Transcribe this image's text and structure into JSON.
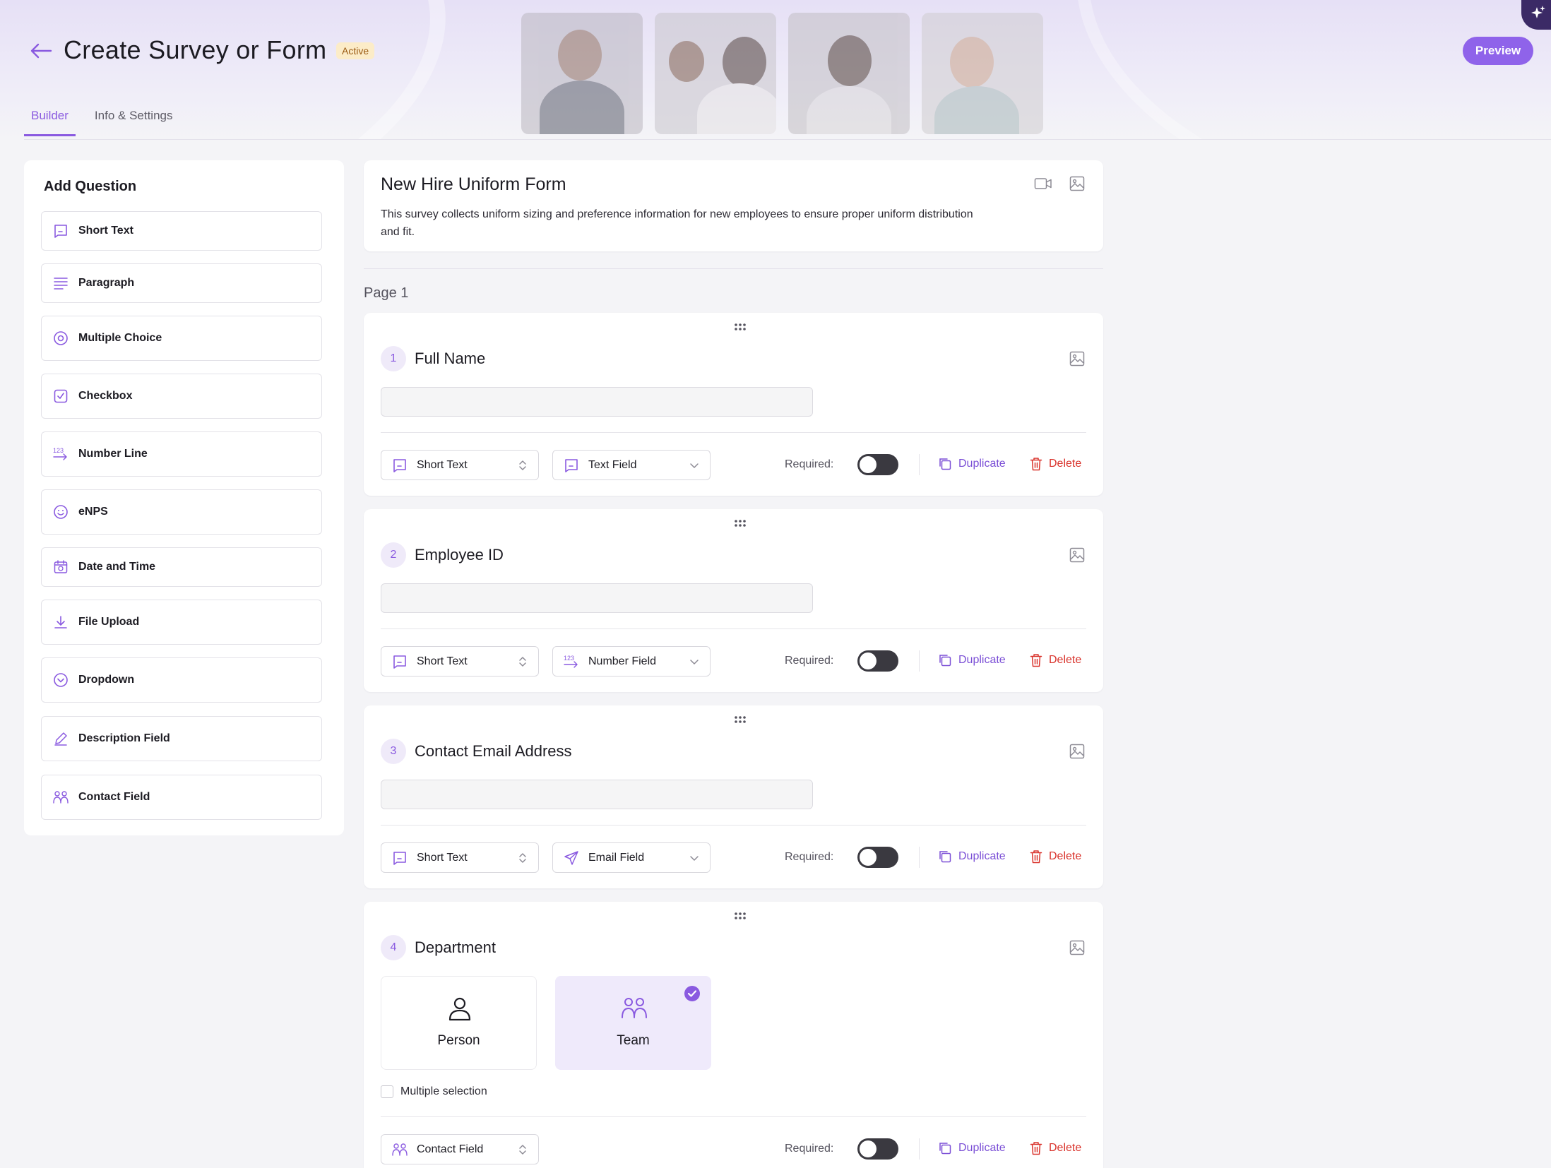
{
  "header": {
    "title": "Create Survey or Form",
    "status": "Active",
    "preview_label": "Preview",
    "tabs": [
      {
        "label": "Builder",
        "active": true
      },
      {
        "label": "Info & Settings",
        "active": false
      }
    ]
  },
  "sidebar": {
    "title": "Add Question",
    "items": [
      {
        "label": "Short Text",
        "icon": "chat-box-icon"
      },
      {
        "label": "Paragraph",
        "icon": "paragraph-lines-icon"
      },
      {
        "label": "Multiple Choice",
        "icon": "radio-circle-icon"
      },
      {
        "label": "Checkbox",
        "icon": "checkbox-icon"
      },
      {
        "label": "Number Line",
        "icon": "number-arrow-icon"
      },
      {
        "label": "eNPS",
        "icon": "smiley-icon"
      },
      {
        "label": "Date and Time",
        "icon": "calendar-icon"
      },
      {
        "label": "File Upload",
        "icon": "download-icon"
      },
      {
        "label": "Dropdown",
        "icon": "chevron-circle-icon"
      },
      {
        "label": "Description Field",
        "icon": "pencil-icon"
      },
      {
        "label": "Contact Field",
        "icon": "people-icon"
      }
    ]
  },
  "form": {
    "title": "New Hire Uniform Form",
    "description": "This survey collects uniform sizing and preference information for new employees to ensure proper uniform distribution and fit.",
    "page_label": "Page 1"
  },
  "questions": [
    {
      "number": "1",
      "title": "Full Name",
      "type_label": "Short Text",
      "subtype_label": "Text Field",
      "subtype_icon": "chat-box-icon",
      "required_label": "Required:",
      "required": false,
      "duplicate_label": "Duplicate",
      "delete_label": "Delete"
    },
    {
      "number": "2",
      "title": "Employee ID",
      "type_label": "Short Text",
      "subtype_label": "Number Field",
      "subtype_icon": "number-arrow-icon",
      "required_label": "Required:",
      "required": false,
      "duplicate_label": "Duplicate",
      "delete_label": "Delete"
    },
    {
      "number": "3",
      "title": "Contact Email Address",
      "type_label": "Short Text",
      "subtype_label": "Email Field",
      "subtype_icon": "paper-plane-icon",
      "required_label": "Required:",
      "required": false,
      "duplicate_label": "Duplicate",
      "delete_label": "Delete"
    },
    {
      "number": "4",
      "title": "Department",
      "type_label": "Contact Field",
      "required_label": "Required:",
      "required": false,
      "duplicate_label": "Duplicate",
      "delete_label": "Delete",
      "options": [
        {
          "label": "Person",
          "icon": "person-icon",
          "selected": false
        },
        {
          "label": "Team",
          "icon": "team-icon",
          "selected": true
        }
      ],
      "multiple_selection_label": "Multiple selection",
      "multiple_selection": false
    }
  ],
  "colors": {
    "accent": "#8a5ae0",
    "delete": "#d9322b",
    "badge_bg": "#fcecc8"
  }
}
